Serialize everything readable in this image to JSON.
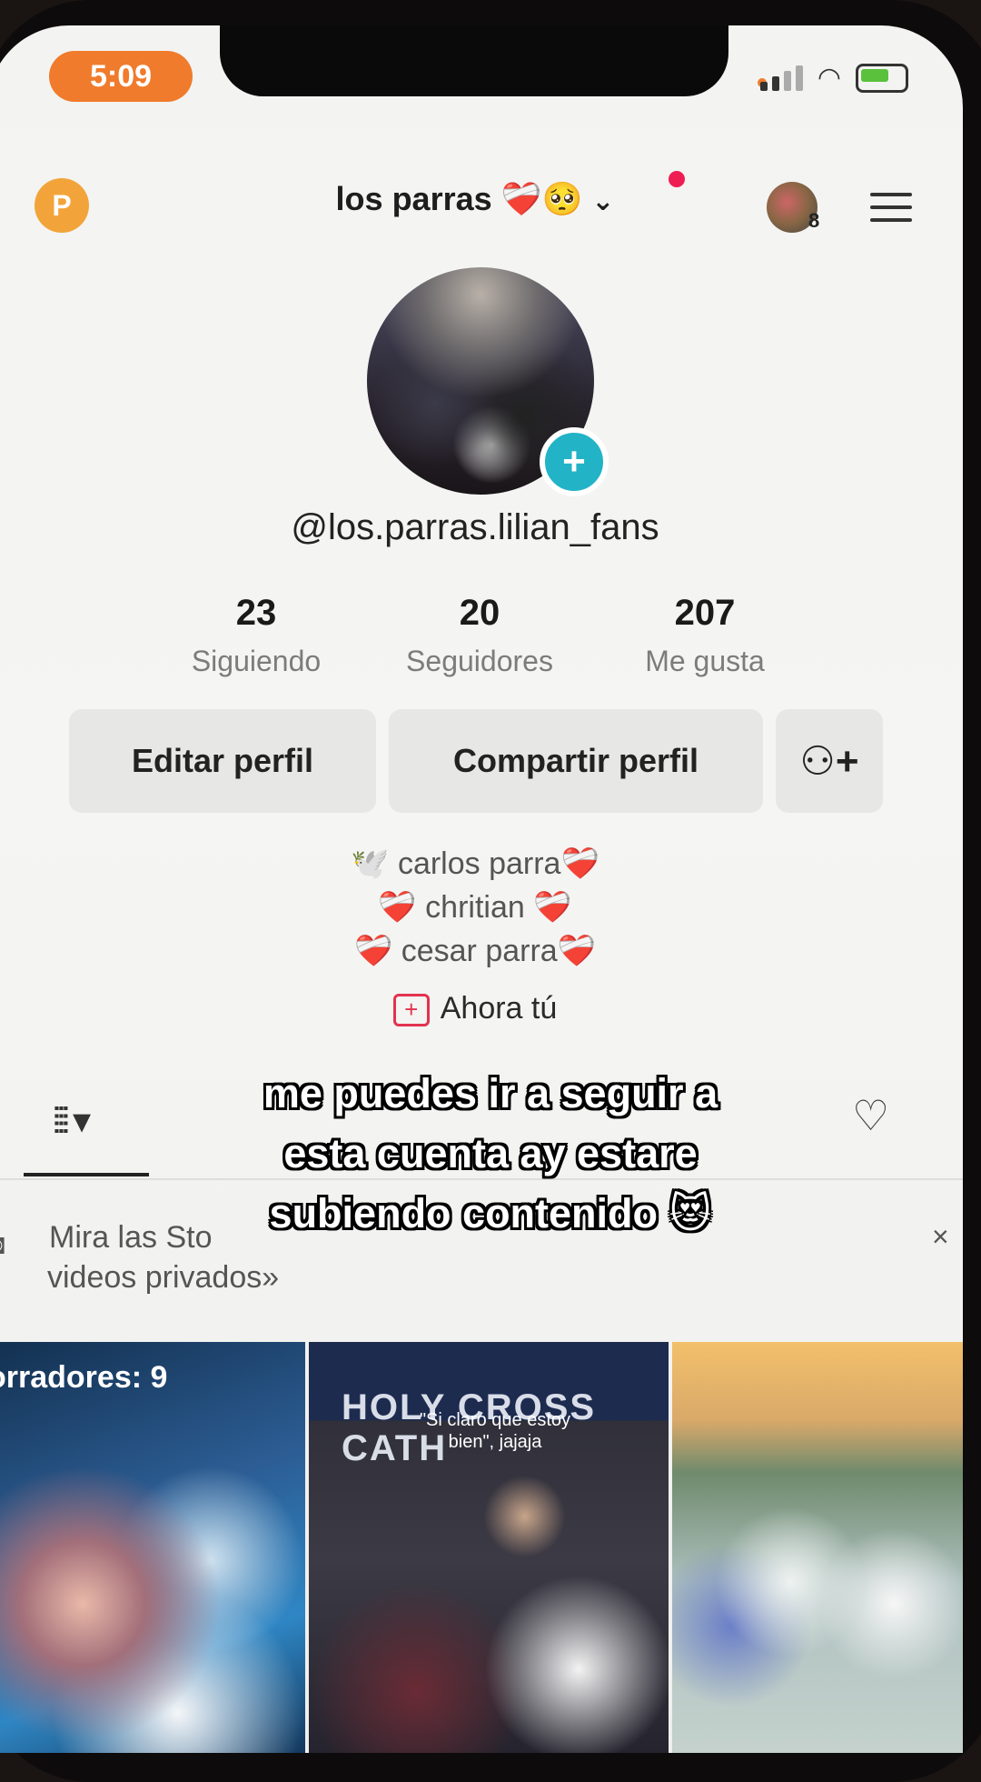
{
  "status_bar": {
    "time": "5:09"
  },
  "header": {
    "profile_badge": "P",
    "title": "los parras ❤️‍🩹🥺",
    "friends_count": "8"
  },
  "profile": {
    "username": "@los.parras.lilian_fans",
    "stats": [
      {
        "value": "23",
        "label": "Siguiendo"
      },
      {
        "value": "20",
        "label": "Seguidores"
      },
      {
        "value": "207",
        "label": "Me gusta"
      }
    ],
    "buttons": {
      "edit": "Editar perfil",
      "share": "Compartir perfil"
    },
    "bio": [
      "🕊️ carlos parra❤️‍🩹",
      "❤️‍🩹 chritian ❤️‍🩹",
      "❤️‍🩹 cesar parra❤️‍🩹"
    ],
    "ahora": "Ahora tú"
  },
  "banner": {
    "line1": "Mira las Sto",
    "line2": "videos privados»"
  },
  "thumbs": {
    "t1_label": "orradores: 9",
    "t2_sign": "HOLY CROSS CATH",
    "t2_caption": "\"Si claro que estoy bien\", jajaja"
  },
  "caption": {
    "line1": "me puedes ir a seguir a",
    "line2": "esta cuenta ay estare",
    "line3": "subiendo contenido 😻"
  },
  "colors": {
    "accent": "#ee1d52",
    "badge": "#22b3c7",
    "time_pill": "#f07b2c"
  }
}
